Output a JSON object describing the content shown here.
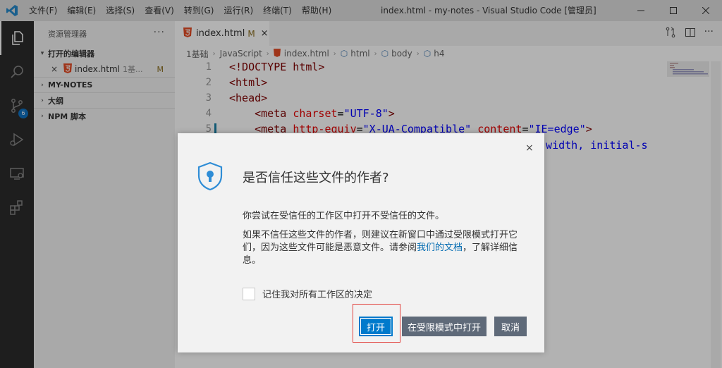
{
  "menu": [
    "文件(F)",
    "编辑(E)",
    "选择(S)",
    "查看(V)",
    "转到(G)",
    "运行(R)",
    "终端(T)",
    "帮助(H)"
  ],
  "window_title": "index.html - my-notes - Visual Studio Code [管理员]",
  "activity": {
    "scm_badge": "6"
  },
  "sidebar": {
    "title": "资源管理器",
    "more": "···",
    "open_editors_label": "打开的编辑器",
    "open_file": {
      "name": "index.html",
      "sub": "1基...",
      "status": "M"
    },
    "sections": [
      "MY-NOTES",
      "大纲",
      "NPM 脚本"
    ]
  },
  "tab": {
    "name": "index.html",
    "status": "M"
  },
  "breadcrumb": [
    "1基础",
    "JavaScript",
    "index.html",
    "html",
    "body",
    "h4"
  ],
  "code_lines": [
    {
      "n": "1",
      "tokens": [
        [
          "tag",
          "<!DOCTYPE html>"
        ]
      ]
    },
    {
      "n": "2",
      "tokens": [
        [
          "tag",
          "<html>"
        ]
      ]
    },
    {
      "n": "3",
      "tokens": [
        [
          "tag",
          "<head>"
        ]
      ]
    },
    {
      "n": "4",
      "tokens": [
        [
          "plain",
          "    "
        ],
        [
          "tag",
          "<meta "
        ],
        [
          "attr",
          "charset"
        ],
        [
          "plain",
          "="
        ],
        [
          "val",
          "\"UTF-8\""
        ],
        [
          "tag",
          ">"
        ]
      ]
    },
    {
      "n": "5",
      "tokens": [
        [
          "plain",
          "    "
        ],
        [
          "tag",
          "<meta "
        ],
        [
          "attr",
          "http-equiv"
        ],
        [
          "plain",
          "="
        ],
        [
          "val",
          "\"X-UA-Compatible\""
        ],
        [
          "plain",
          " "
        ],
        [
          "attr",
          "content"
        ],
        [
          "plain",
          "="
        ],
        [
          "val",
          "\"IE=edge\""
        ],
        [
          "tag",
          ">"
        ]
      ]
    }
  ],
  "behind_dialog_text": "e-width, initial-s",
  "dialog": {
    "close": "×",
    "title": "是否信任这些文件的作者?",
    "p1": "你尝试在受信任的工作区中打开不受信任的文件。",
    "p2_before": "如果不信任这些文件的作者，则建议在新窗口中通过受限模式打开它们，因为这些文件可能是恶意文件。请参阅",
    "p2_link": "我们的文档",
    "p2_after": "，了解详细信息。",
    "remember_label": "记住我对所有工作区的决定",
    "open_button": "打开",
    "restricted_button": "在受限模式中打开",
    "cancel_button": "取消"
  },
  "colors": {
    "accent": "#007acc",
    "highlight": "#e2423e",
    "secondary_button": "#5f6a79"
  }
}
